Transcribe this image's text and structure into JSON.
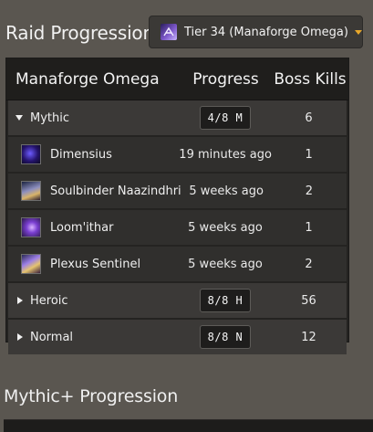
{
  "raid": {
    "title": "Raid Progression",
    "tier_select": {
      "value": "Tier 34 (Manaforge Omega)",
      "icon": "raid-tier-icon",
      "caret_color": "#e8a72a"
    },
    "table": {
      "headers": {
        "name": "Manaforge Omega",
        "progress": "Progress",
        "kills": "Boss Kills"
      },
      "mythic": {
        "label": "Mythic",
        "progress": "4/8 M",
        "kills": "6",
        "expanded": true
      },
      "bosses": [
        {
          "name": "Dimensius",
          "progress": "19 minutes ago",
          "kills": "1",
          "icon": "dimensius-portrait-icon"
        },
        {
          "name": "Soulbinder Naazindhri",
          "progress": "5 weeks ago",
          "kills": "2",
          "icon": "naazindhri-portrait-icon"
        },
        {
          "name": "Loom'ithar",
          "progress": "5 weeks ago",
          "kills": "1",
          "icon": "loomithar-portrait-icon"
        },
        {
          "name": "Plexus Sentinel",
          "progress": "5 weeks ago",
          "kills": "2",
          "icon": "plexus-sentinel-portrait-icon"
        }
      ],
      "heroic": {
        "label": "Heroic",
        "progress": "8/8 H",
        "kills": "56",
        "expanded": false
      },
      "normal": {
        "label": "Normal",
        "progress": "8/8 N",
        "kills": "12",
        "expanded": false
      }
    }
  },
  "mplus": {
    "title": "Mythic+ Progression"
  }
}
